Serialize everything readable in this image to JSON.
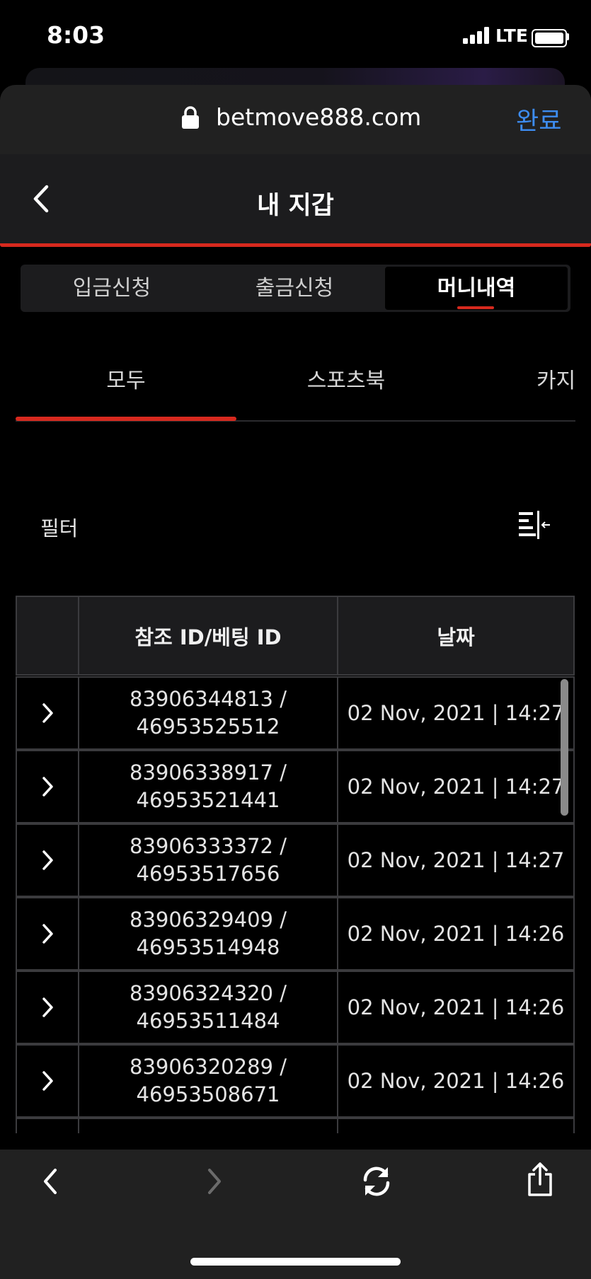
{
  "status_bar": {
    "time": "8:03",
    "network": "LTE"
  },
  "browser": {
    "url": "betmove888.com",
    "done_label": "완료"
  },
  "header": {
    "title": "내 지갑"
  },
  "segments": [
    {
      "label": "입금신청",
      "active": false
    },
    {
      "label": "출금신청",
      "active": false
    },
    {
      "label": "머니내역",
      "active": true
    }
  ],
  "categories": [
    {
      "label": "모두",
      "active": true
    },
    {
      "label": "스포츠북",
      "active": false
    },
    {
      "label": "카지",
      "active": false
    }
  ],
  "filter": {
    "label": "필터"
  },
  "table": {
    "columns": [
      "",
      "참조 ID/베팅 ID",
      "날짜"
    ],
    "rows": [
      {
        "ref_id": "83906344813 /",
        "bet_id": "46953525512",
        "date": "02 Nov, 2021 | 14:27"
      },
      {
        "ref_id": "83906338917 /",
        "bet_id": "46953521441",
        "date": "02 Nov, 2021 | 14:27"
      },
      {
        "ref_id": "83906333372 /",
        "bet_id": "46953517656",
        "date": "02 Nov, 2021 | 14:27"
      },
      {
        "ref_id": "83906329409 /",
        "bet_id": "46953514948",
        "date": "02 Nov, 2021 | 14:26"
      },
      {
        "ref_id": "83906324320 /",
        "bet_id": "46953511484",
        "date": "02 Nov, 2021 | 14:26"
      },
      {
        "ref_id": "83906320289 /",
        "bet_id": "46953508671",
        "date": "02 Nov, 2021 | 14:26"
      }
    ]
  },
  "colors": {
    "accent": "#d7291e",
    "link": "#3d8cf0",
    "background": "#000000",
    "surface": "#1c1c1e"
  },
  "icons": [
    "lock-icon",
    "back-chevron-icon",
    "filter-icon",
    "row-chevron-icon",
    "browser-back-icon",
    "browser-forward-icon",
    "reload-icon",
    "share-icon"
  ]
}
